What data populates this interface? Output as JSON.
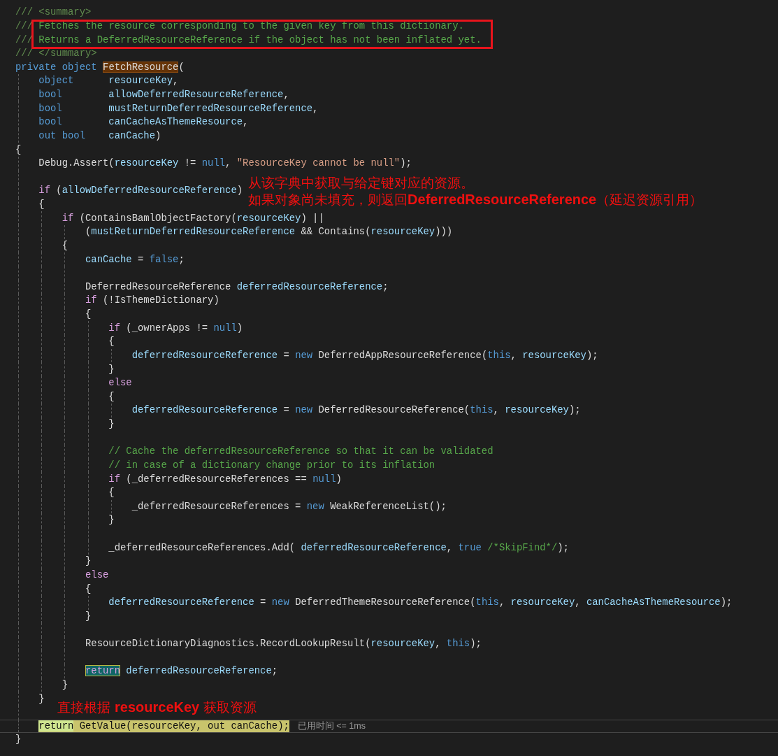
{
  "editor": {
    "lines": [
      {
        "tokens": [
          {
            "kind": "doc",
            "text": "/// <summary>"
          }
        ]
      },
      {
        "boxed": true,
        "tokens": [
          {
            "kind": "doc",
            "text": "///"
          },
          {
            "kind": "comment",
            "text": " Fetches the resource corresponding to the given key from this dictionary."
          }
        ]
      },
      {
        "boxed": true,
        "tokens": [
          {
            "kind": "doc",
            "text": "///"
          },
          {
            "kind": "comment",
            "text": " Returns a DeferredResourceReference if the object has not been inflated yet."
          }
        ]
      },
      {
        "tokens": [
          {
            "kind": "doc",
            "text": "/// </summary>"
          }
        ]
      },
      {
        "tokens": [
          {
            "kind": "keyword",
            "text": "private object "
          },
          {
            "kind": "plain",
            "text": "FetchResource",
            "highlighted": true
          },
          {
            "kind": "plain",
            "text": "("
          }
        ]
      },
      {
        "tokens": [
          {
            "kind": "keyword",
            "text": "    object"
          },
          {
            "kind": "variable",
            "text": "      resourceKey"
          },
          {
            "kind": "plain",
            "text": ","
          }
        ]
      },
      {
        "tokens": [
          {
            "kind": "keyword",
            "text": "    bool"
          },
          {
            "kind": "variable",
            "text": "        allowDeferredResourceReference"
          },
          {
            "kind": "plain",
            "text": ","
          }
        ]
      },
      {
        "tokens": [
          {
            "kind": "keyword",
            "text": "    bool"
          },
          {
            "kind": "variable",
            "text": "        mustReturnDeferredResourceReference"
          },
          {
            "kind": "plain",
            "text": ","
          }
        ]
      },
      {
        "tokens": [
          {
            "kind": "keyword",
            "text": "    bool"
          },
          {
            "kind": "variable",
            "text": "        canCacheAsThemeResource"
          },
          {
            "kind": "plain",
            "text": ","
          }
        ]
      },
      {
        "tokens": [
          {
            "kind": "keyword",
            "text": "    out bool"
          },
          {
            "kind": "variable",
            "text": "    canCache"
          },
          {
            "kind": "plain",
            "text": ")"
          }
        ]
      },
      {
        "tokens": [
          {
            "kind": "plain",
            "text": "{"
          }
        ]
      },
      {
        "tokens": [
          {
            "kind": "plain",
            "text": "    Debug.Assert("
          },
          {
            "kind": "variable",
            "text": "resourceKey"
          },
          {
            "kind": "plain",
            "text": " != "
          },
          {
            "kind": "keyword",
            "text": "null"
          },
          {
            "kind": "plain",
            "text": ", "
          },
          {
            "kind": "string",
            "text": "\"ResourceKey cannot be null\""
          },
          {
            "kind": "plain",
            "text": ");"
          }
        ]
      },
      {
        "kind": "blank"
      },
      {
        "tokens": [
          {
            "kind": "control",
            "text": "    if"
          },
          {
            "kind": "plain",
            "text": " ("
          },
          {
            "kind": "variable",
            "text": "allowDeferredResourceReference"
          },
          {
            "kind": "plain",
            "text": ")"
          }
        ],
        "note": [
          "从该字典中获取与给定键对应的资源。",
          "如果对象尚未填充，则返回**DeferredResourceReference**（延迟资源引用）"
        ]
      },
      {
        "tokens": [
          {
            "kind": "plain",
            "text": "    {"
          }
        ]
      },
      {
        "tokens": [
          {
            "kind": "control",
            "text": "        if"
          },
          {
            "kind": "plain",
            "text": " (ContainsBamlObjectFactory("
          },
          {
            "kind": "variable",
            "text": "resourceKey"
          },
          {
            "kind": "plain",
            "text": ") ||"
          }
        ]
      },
      {
        "tokens": [
          {
            "kind": "plain",
            "text": "            ("
          },
          {
            "kind": "variable",
            "text": "mustReturnDeferredResourceReference"
          },
          {
            "kind": "plain",
            "text": " && Contains("
          },
          {
            "kind": "variable",
            "text": "resourceKey"
          },
          {
            "kind": "plain",
            "text": ")))"
          }
        ]
      },
      {
        "tokens": [
          {
            "kind": "plain",
            "text": "        {"
          }
        ]
      },
      {
        "tokens": [
          {
            "kind": "variable",
            "text": "            canCache"
          },
          {
            "kind": "plain",
            "text": " = "
          },
          {
            "kind": "keyword",
            "text": "false"
          },
          {
            "kind": "plain",
            "text": ";"
          }
        ]
      },
      {
        "kind": "blank"
      },
      {
        "tokens": [
          {
            "kind": "plain",
            "text": "            DeferredResourceReference "
          },
          {
            "kind": "variable",
            "text": "deferredResourceReference"
          },
          {
            "kind": "plain",
            "text": ";"
          }
        ]
      },
      {
        "tokens": [
          {
            "kind": "control",
            "text": "            if"
          },
          {
            "kind": "plain",
            "text": " (!IsThemeDictionary)"
          }
        ]
      },
      {
        "tokens": [
          {
            "kind": "plain",
            "text": "            {"
          }
        ]
      },
      {
        "tokens": [
          {
            "kind": "control",
            "text": "                if"
          },
          {
            "kind": "plain",
            "text": " (_ownerApps != "
          },
          {
            "kind": "keyword",
            "text": "null"
          },
          {
            "kind": "plain",
            "text": ")"
          }
        ]
      },
      {
        "tokens": [
          {
            "kind": "plain",
            "text": "                {"
          }
        ]
      },
      {
        "tokens": [
          {
            "kind": "variable",
            "text": "                    deferredResourceReference"
          },
          {
            "kind": "plain",
            "text": " = "
          },
          {
            "kind": "keyword",
            "text": "new"
          },
          {
            "kind": "plain",
            "text": " DeferredAppResourceReference("
          },
          {
            "kind": "keyword",
            "text": "this"
          },
          {
            "kind": "plain",
            "text": ", "
          },
          {
            "kind": "variable",
            "text": "resourceKey"
          },
          {
            "kind": "plain",
            "text": ");"
          }
        ]
      },
      {
        "tokens": [
          {
            "kind": "plain",
            "text": "                }"
          }
        ]
      },
      {
        "tokens": [
          {
            "kind": "control",
            "text": "                else"
          }
        ]
      },
      {
        "tokens": [
          {
            "kind": "plain",
            "text": "                {"
          }
        ]
      },
      {
        "tokens": [
          {
            "kind": "variable",
            "text": "                    deferredResourceReference"
          },
          {
            "kind": "plain",
            "text": " = "
          },
          {
            "kind": "keyword",
            "text": "new"
          },
          {
            "kind": "plain",
            "text": " DeferredResourceReference("
          },
          {
            "kind": "keyword",
            "text": "this"
          },
          {
            "kind": "plain",
            "text": ", "
          },
          {
            "kind": "variable",
            "text": "resourceKey"
          },
          {
            "kind": "plain",
            "text": ");"
          }
        ]
      },
      {
        "tokens": [
          {
            "kind": "plain",
            "text": "                }"
          }
        ]
      },
      {
        "kind": "blank"
      },
      {
        "tokens": [
          {
            "kind": "comment",
            "text": "                // Cache the deferredResourceReference so that it can be validated"
          }
        ]
      },
      {
        "tokens": [
          {
            "kind": "comment",
            "text": "                // in case of a dictionary change prior to its inflation"
          }
        ]
      },
      {
        "tokens": [
          {
            "kind": "control",
            "text": "                if"
          },
          {
            "kind": "plain",
            "text": " (_deferredResourceReferences == "
          },
          {
            "kind": "keyword",
            "text": "null"
          },
          {
            "kind": "plain",
            "text": ")"
          }
        ]
      },
      {
        "tokens": [
          {
            "kind": "plain",
            "text": "                {"
          }
        ]
      },
      {
        "tokens": [
          {
            "kind": "plain",
            "text": "                    _deferredResourceReferences = "
          },
          {
            "kind": "keyword",
            "text": "new"
          },
          {
            "kind": "plain",
            "text": " WeakReferenceList();"
          }
        ]
      },
      {
        "tokens": [
          {
            "kind": "plain",
            "text": "                }"
          }
        ]
      },
      {
        "kind": "blank"
      },
      {
        "tokens": [
          {
            "kind": "plain",
            "text": "                _deferredResourceReferences.Add( "
          },
          {
            "kind": "variable",
            "text": "deferredResourceReference"
          },
          {
            "kind": "plain",
            "text": ", "
          },
          {
            "kind": "keyword",
            "text": "true"
          },
          {
            "kind": "comment",
            "text": " /*SkipFind*/"
          },
          {
            "kind": "plain",
            "text": ");"
          }
        ]
      },
      {
        "tokens": [
          {
            "kind": "plain",
            "text": "            }"
          }
        ]
      },
      {
        "tokens": [
          {
            "kind": "control",
            "text": "            else"
          }
        ]
      },
      {
        "tokens": [
          {
            "kind": "plain",
            "text": "            {"
          }
        ]
      },
      {
        "tokens": [
          {
            "kind": "variable",
            "text": "                deferredResourceReference"
          },
          {
            "kind": "plain",
            "text": " = "
          },
          {
            "kind": "keyword",
            "text": "new"
          },
          {
            "kind": "plain",
            "text": " DeferredThemeResourceReference("
          },
          {
            "kind": "keyword",
            "text": "this"
          },
          {
            "kind": "plain",
            "text": ", "
          },
          {
            "kind": "variable",
            "text": "resourceKey"
          },
          {
            "kind": "plain",
            "text": ", "
          },
          {
            "kind": "variable",
            "text": "canCacheAsThemeResource"
          },
          {
            "kind": "plain",
            "text": ");"
          }
        ]
      },
      {
        "tokens": [
          {
            "kind": "plain",
            "text": "            }"
          }
        ]
      },
      {
        "kind": "blank"
      },
      {
        "tokens": [
          {
            "kind": "plain",
            "text": "            ResourceDictionaryDiagnostics.RecordLookupResult("
          },
          {
            "kind": "variable",
            "text": "resourceKey"
          },
          {
            "kind": "plain",
            "text": ", "
          },
          {
            "kind": "keyword",
            "text": "this"
          },
          {
            "kind": "plain",
            "text": ");"
          }
        ]
      },
      {
        "kind": "blank"
      },
      {
        "tokens": [
          {
            "kind": "control",
            "text": "            return",
            "highlighted": true
          },
          {
            "kind": "variable",
            "text": " deferredResourceReference"
          },
          {
            "kind": "plain",
            "text": ";"
          }
        ]
      },
      {
        "tokens": [
          {
            "kind": "plain",
            "text": "        }"
          }
        ]
      },
      {
        "tokens": [
          {
            "kind": "plain",
            "text": "    }"
          }
        ]
      },
      {
        "kind": "blank",
        "note": [
          "直接根据 **resourceKey** 获取资源"
        ]
      },
      {
        "current": true,
        "highlighted": true,
        "hint": "已用时间 <= 1ms",
        "tokens": [
          {
            "kind": "control",
            "text": "    return",
            "highlighted": true
          },
          {
            "kind": "plain",
            "text": " GetValue("
          },
          {
            "kind": "variable",
            "text": "resourceKey"
          },
          {
            "kind": "plain",
            "text": ", "
          },
          {
            "kind": "keyword",
            "text": "out"
          },
          {
            "kind": "variable",
            "text": " canCache"
          },
          {
            "kind": "plain",
            "text": ");"
          }
        ]
      },
      {
        "tokens": [
          {
            "kind": "plain",
            "text": "}"
          }
        ]
      }
    ]
  }
}
